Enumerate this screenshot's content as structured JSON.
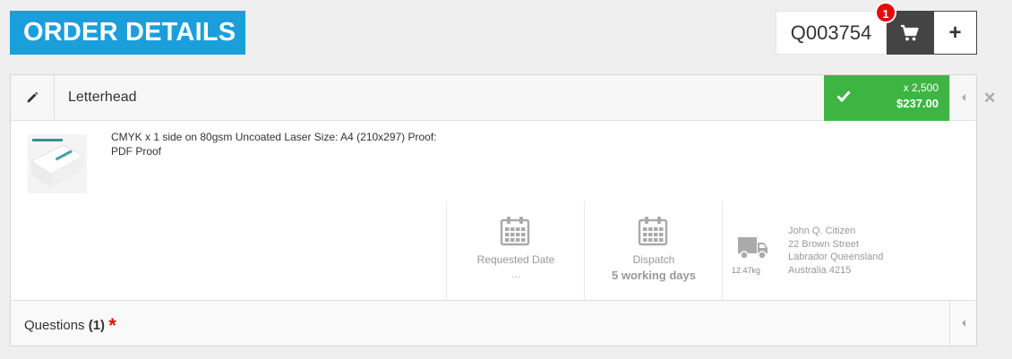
{
  "page": {
    "title": "ORDER DETAILS"
  },
  "header": {
    "quote_number": "Q003754",
    "cart_count": "1",
    "add_label": "+"
  },
  "item": {
    "name": "Letterhead",
    "quantity": "x 2,500",
    "price": "$237.00",
    "description_line1": "CMYK x 1 side on 80gsm Uncoated Laser Size: A4 (210x297) Proof:",
    "description_line2": "PDF Proof",
    "requested_date_label": "Requested Date",
    "requested_date_value": "...",
    "dispatch_label": "Dispatch",
    "dispatch_value": "5 working days",
    "weight": "12.47kg",
    "address": [
      "John Q. Citizen",
      "22 Brown Street",
      "Labrador Queensland",
      "Australia 4215"
    ]
  },
  "questions": {
    "label": "Questions",
    "count": "(1)",
    "required_mark": "*"
  },
  "colors": {
    "brand_blue": "#1a9fdb",
    "price_green": "#3eb543",
    "badge_red": "#e30b0b",
    "cart_dark": "#444444"
  },
  "icons": [
    "cart-icon",
    "pencil-icon",
    "check-icon",
    "calendar-icon",
    "truck-icon",
    "caret-left-icon",
    "close-icon"
  ]
}
